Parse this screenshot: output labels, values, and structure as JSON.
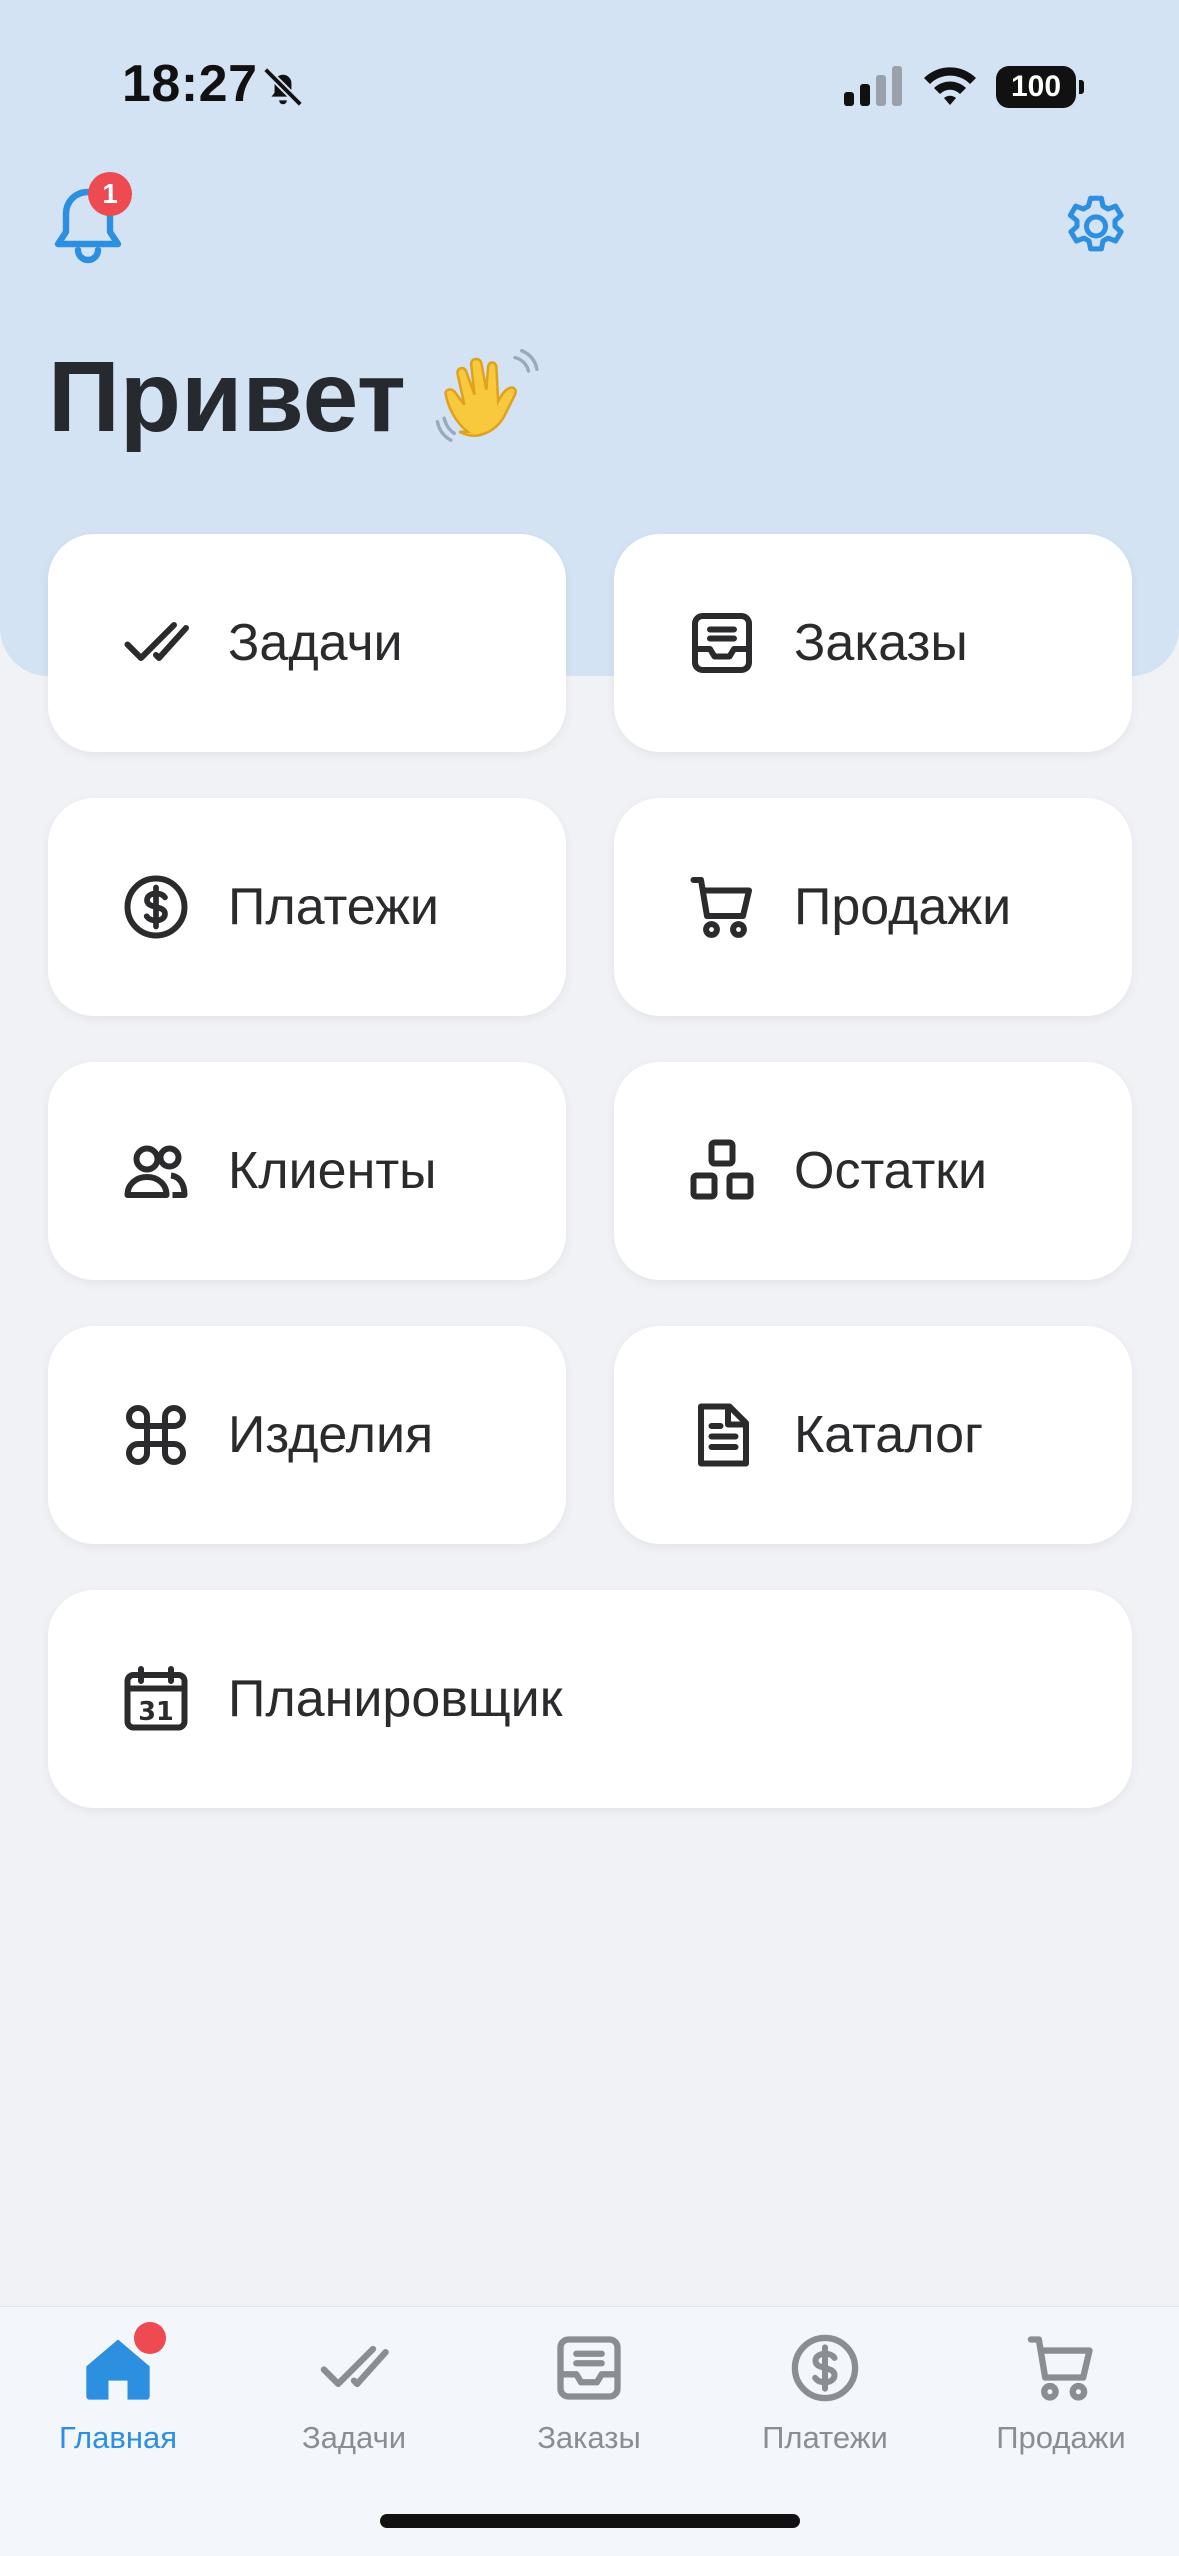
{
  "status_bar": {
    "time": "18:27",
    "battery": "100"
  },
  "header": {
    "notification_count": "1",
    "greeting": "Привет"
  },
  "tiles": [
    {
      "label": "Задачи",
      "icon": "check-icon"
    },
    {
      "label": "Заказы",
      "icon": "inbox-icon"
    },
    {
      "label": "Платежи",
      "icon": "dollar-circle-icon"
    },
    {
      "label": "Продажи",
      "icon": "cart-icon"
    },
    {
      "label": "Клиенты",
      "icon": "users-icon"
    },
    {
      "label": "Остатки",
      "icon": "boxes-icon"
    },
    {
      "label": "Изделия",
      "icon": "command-icon"
    },
    {
      "label": "Каталог",
      "icon": "document-icon"
    },
    {
      "label": "Планировщик",
      "icon": "calendar-icon"
    }
  ],
  "tabbar": {
    "tabs": [
      {
        "label": "Главная",
        "icon": "home-icon",
        "active": true
      },
      {
        "label": "Задачи",
        "icon": "check-icon"
      },
      {
        "label": "Заказы",
        "icon": "inbox-icon"
      },
      {
        "label": "Платежи",
        "icon": "dollar-circle-icon"
      },
      {
        "label": "Продажи",
        "icon": "cart-icon"
      }
    ]
  },
  "colors": {
    "accent": "#2d8fe0",
    "badge": "#ee4a52",
    "header_bg": "#d4e3f3",
    "page_bg": "#f1f2f6"
  }
}
